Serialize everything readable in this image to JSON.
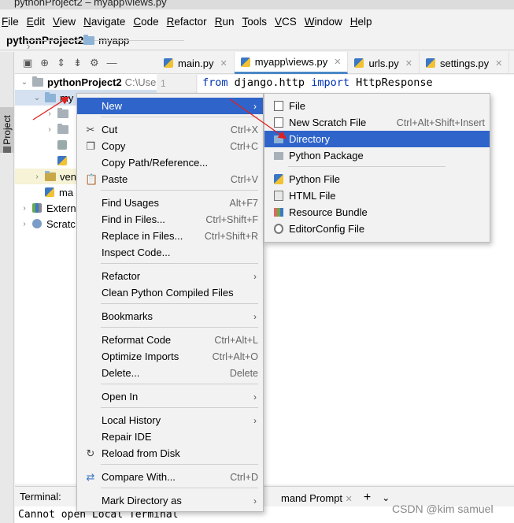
{
  "window": {
    "title": "pythonProject2 – myapp\\views.py"
  },
  "menubar": [
    "File",
    "Edit",
    "View",
    "Navigate",
    "Code",
    "Refactor",
    "Run",
    "Tools",
    "VCS",
    "Window",
    "Help"
  ],
  "breadcrumb": {
    "project": "pythonProject2",
    "folder": "myapp"
  },
  "stripe": {
    "project_tab": "Project"
  },
  "tree": {
    "root_name": "pythonProject2",
    "root_path": "C:\\Use",
    "selected": "my",
    "venv": "ven",
    "main_file": "ma",
    "external": "Extern",
    "scratches": "Scratc"
  },
  "tabs": [
    "main.py",
    "myapp\\views.py",
    "urls.py",
    "settings.py"
  ],
  "editor": {
    "line_number": "1",
    "kw_from": "from",
    "module": "django.http",
    "kw_import": "import",
    "name": "HttpResponse"
  },
  "context_menu": {
    "new": "New",
    "cut": "Cut",
    "cut_sc": "Ctrl+X",
    "copy": "Copy",
    "copy_sc": "Ctrl+C",
    "copy_path": "Copy Path/Reference...",
    "paste": "Paste",
    "paste_sc": "Ctrl+V",
    "find_usages": "Find Usages",
    "find_usages_sc": "Alt+F7",
    "find_in_files": "Find in Files...",
    "find_in_files_sc": "Ctrl+Shift+F",
    "replace_in_files": "Replace in Files...",
    "replace_in_files_sc": "Ctrl+Shift+R",
    "inspect_code": "Inspect Code...",
    "refactor": "Refactor",
    "clean_python": "Clean Python Compiled Files",
    "bookmarks": "Bookmarks",
    "reformat": "Reformat Code",
    "reformat_sc": "Ctrl+Alt+L",
    "optimize_imports": "Optimize Imports",
    "optimize_imports_sc": "Ctrl+Alt+O",
    "delete": "Delete...",
    "delete_sc": "Delete",
    "open_in": "Open In",
    "local_history": "Local History",
    "repair_ide": "Repair IDE",
    "reload": "Reload from Disk",
    "compare": "Compare With...",
    "compare_sc": "Ctrl+D",
    "mark_directory": "Mark Directory as"
  },
  "submenu": {
    "file": "File",
    "scratch": "New Scratch File",
    "scratch_sc": "Ctrl+Alt+Shift+Insert",
    "directory": "Directory",
    "python_package": "Python Package",
    "python_file": "Python File",
    "html_file": "HTML File",
    "resource_bundle": "Resource Bundle",
    "editorconfig": "EditorConfig File"
  },
  "terminal": {
    "label": "Terminal:",
    "tab": "mand Prompt",
    "output": "Cannot open Local Terminal"
  },
  "watermark": "CSDN @kim samuel",
  "colors": {
    "highlight": "#2f65ca",
    "keyword": "#0033b3",
    "arrow": "#e02020"
  }
}
